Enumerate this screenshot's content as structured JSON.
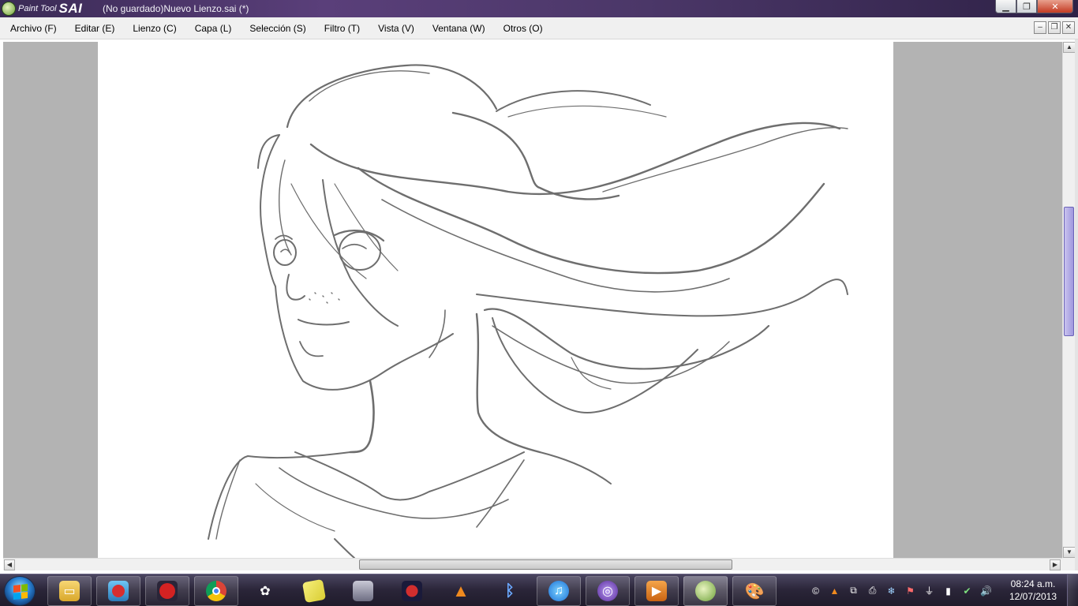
{
  "window": {
    "logo_text": "Paint Tool",
    "logo_brand": "SAI",
    "title": "(No guardado)Nuevo Lienzo.sai (*)"
  },
  "menu": [
    {
      "label": "Archivo (F)"
    },
    {
      "label": "Editar (E)"
    },
    {
      "label": "Lienzo (C)"
    },
    {
      "label": "Capa (L)"
    },
    {
      "label": "Selección (S)"
    },
    {
      "label": "Filtro (T)"
    },
    {
      "label": "Vista (V)"
    },
    {
      "label": "Ventana (W)"
    },
    {
      "label": "Otros (O)"
    }
  ],
  "canvas": {
    "content": "pencil sketch",
    "background_color": "#ffffff",
    "workspace_color": "#b3b3b3",
    "stroke_color": "#6e6e6e"
  },
  "scroll": {
    "vertical_position": 0.32,
    "horizontal_position": 0.34
  },
  "taskbar": {
    "apps": [
      {
        "name": "file-explorer",
        "icon": "folder-icon",
        "pinned": true
      },
      {
        "name": "angry-birds",
        "icon": "angry-birds-icon",
        "pinned": true
      },
      {
        "name": "angry-birds-2",
        "icon": "angry-birds-red-icon",
        "pinned": true
      },
      {
        "name": "chrome",
        "icon": "chrome-icon",
        "pinned": true
      },
      {
        "name": "plants-vs-zombies",
        "icon": "flower-icon",
        "pinned": false
      },
      {
        "name": "sticky-notes",
        "icon": "notes-icon",
        "pinned": false
      },
      {
        "name": "devil-may-cry",
        "icon": "game-character-icon",
        "pinned": false
      },
      {
        "name": "angry-birds-space",
        "icon": "angry-birds-space-icon",
        "pinned": false
      },
      {
        "name": "vlc",
        "icon": "vlc-cone-icon",
        "pinned": false
      },
      {
        "name": "bluetooth",
        "icon": "bluetooth-icon",
        "pinned": false
      },
      {
        "name": "itunes",
        "icon": "itunes-icon",
        "pinned": true
      },
      {
        "name": "bittorrent",
        "icon": "bittorrent-icon",
        "pinned": true
      },
      {
        "name": "media-player",
        "icon": "play-icon",
        "pinned": true
      },
      {
        "name": "paint-tool-sai",
        "icon": "sai-icon",
        "pinned": true
      },
      {
        "name": "paint",
        "icon": "palette-icon",
        "pinned": true
      }
    ],
    "tray_icons": [
      "copyright-icon",
      "vlc-tray-icon",
      "network-icon",
      "printer-icon",
      "snowflake-icon",
      "flag-icon",
      "usb-icon",
      "signal-icon",
      "sync-icon",
      "volume-icon"
    ],
    "time": "08:24 a.m.",
    "date": "12/07/2013"
  }
}
